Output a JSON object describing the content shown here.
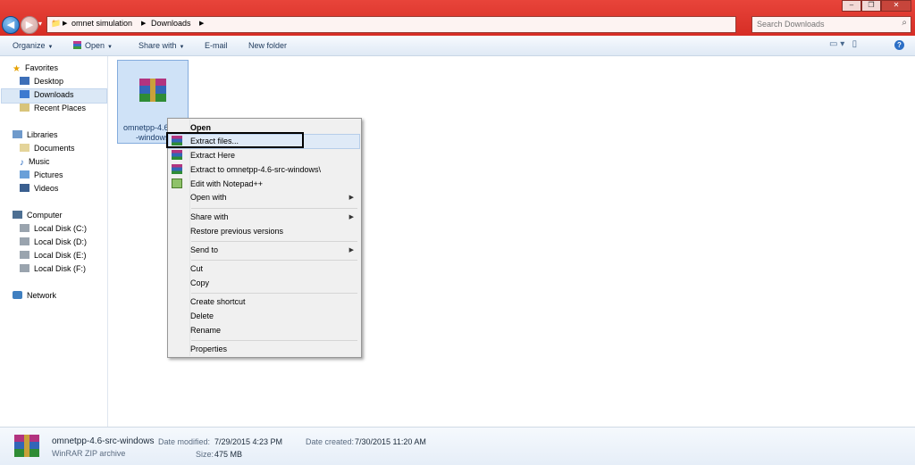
{
  "window": {
    "breadcrumbs": [
      "omnet simulation",
      "Downloads"
    ],
    "search_placeholder": "Search Downloads",
    "controls": {
      "minimize": "–",
      "maximize": "❐",
      "close": "✕"
    }
  },
  "toolbar": {
    "organize": "Organize",
    "open": "Open",
    "share_with": "Share with",
    "email": "E-mail",
    "new_folder": "New folder"
  },
  "nav": {
    "favorites": "Favorites",
    "desktop": "Desktop",
    "downloads": "Downloads",
    "recent_places": "Recent Places",
    "libraries": "Libraries",
    "documents": "Documents",
    "music": "Music",
    "pictures": "Pictures",
    "videos": "Videos",
    "computer": "Computer",
    "disk_c": "Local Disk (C:)",
    "disk_d": "Local Disk (D:)",
    "disk_e": "Local Disk (E:)",
    "disk_f": "Local Disk (F:)",
    "network": "Network"
  },
  "file": {
    "name_line1": "omnetpp-4.6",
    "name_line2": "-windows"
  },
  "context_menu": {
    "open": "Open",
    "extract_files": "Extract files...",
    "extract_here": "Extract Here",
    "extract_to": "Extract to omnetpp-4.6-src-windows\\",
    "edit_notepad": "Edit with Notepad++",
    "open_with": "Open with",
    "share_with": "Share with",
    "restore_versions": "Restore previous versions",
    "send_to": "Send to",
    "cut": "Cut",
    "copy": "Copy",
    "create_shortcut": "Create shortcut",
    "delete": "Delete",
    "rename": "Rename",
    "properties": "Properties"
  },
  "details": {
    "file_name": "omnetpp-4.6-src-windows",
    "file_type": "WinRAR ZIP archive",
    "date_modified_label": "Date modified:",
    "date_modified": "7/29/2015 4:23 PM",
    "size_label": "Size:",
    "size": "475 MB",
    "date_created_label": "Date created:",
    "date_created": "7/30/2015 11:20 AM"
  },
  "colors": {
    "titlebar": "#d62d25",
    "selection": "#cfe2f7",
    "menu_bg": "#f0f0f0"
  }
}
